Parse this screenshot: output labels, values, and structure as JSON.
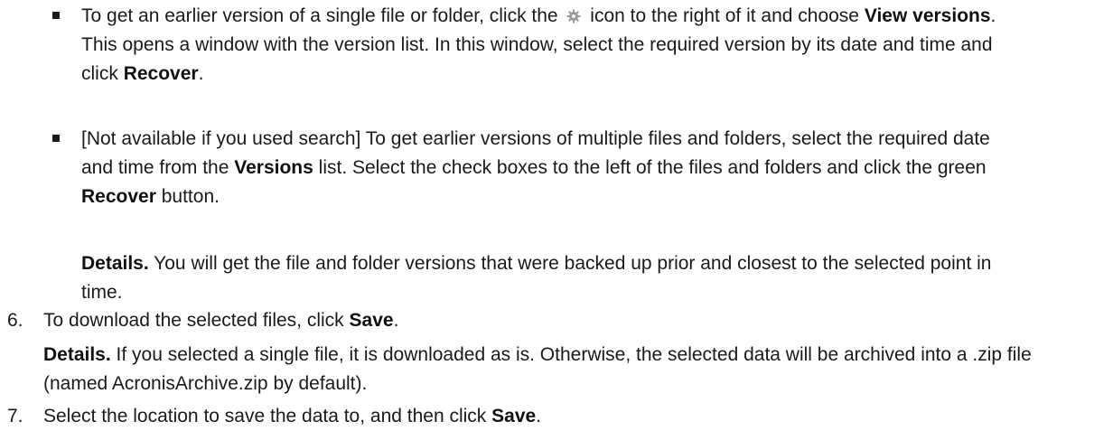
{
  "items": {
    "bullet1": {
      "pre": "To get an earlier version of a single file or folder, click the",
      "icon": "gear-icon",
      "post_a": "icon to the right of it and choose",
      "bold1": "View versions",
      "post_b": ". This opens a window with the version list. In this window, select the required version by its date and time and click",
      "bold2": "Recover",
      "end": "."
    },
    "bullet2": {
      "pre": "[Not available if you used search] To get earlier versions of multiple files and folders, select the required date and time from the",
      "bold1": "Versions",
      "mid": "list. Select the check boxes to the left of the files and folders and click the green",
      "bold2": "Recover",
      "end": "button."
    },
    "bullet2_details": {
      "label": "Details.",
      "text": "You will get the file and folder versions that were backed up prior and closest to the selected point in time."
    },
    "step6": {
      "number": "6.",
      "pre": "To download the selected files, click",
      "bold": "Save",
      "end": "."
    },
    "step6_details": {
      "label": "Details.",
      "text": "If you selected a single file, it is downloaded as is. Otherwise, the selected data will be archived into a .zip file (named AcronisArchive.zip by default)."
    },
    "step7": {
      "number": "7.",
      "pre": "Select the location to save the data to, and then click",
      "bold": "Save",
      "end": "."
    }
  },
  "colors": {
    "text": "#1a1a1a",
    "icon": "#9a9a9a"
  }
}
